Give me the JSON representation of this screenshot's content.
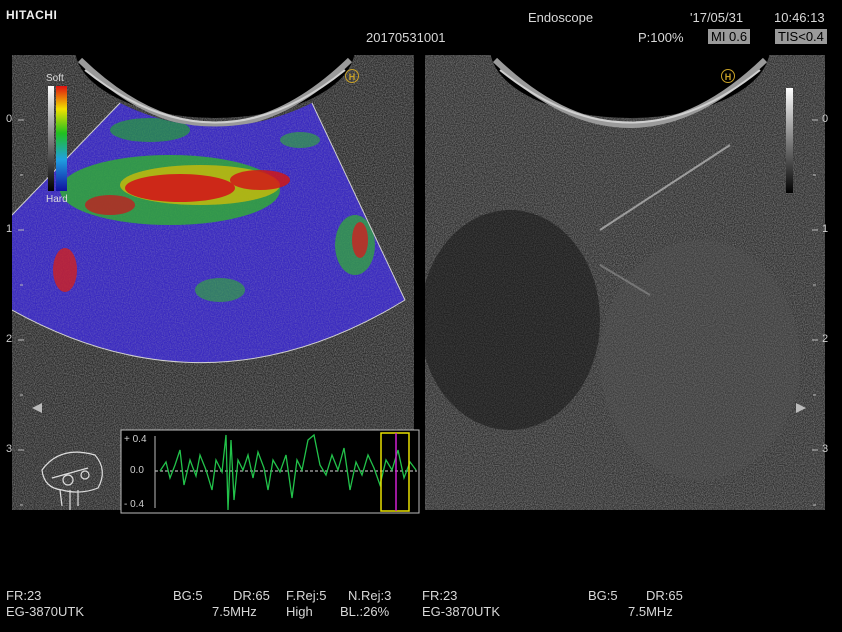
{
  "header": {
    "brand": "HITACHI",
    "mode": "Endoscope",
    "date": "'17/05/31",
    "time": "10:46:13",
    "patient_id": "20170531001",
    "power": "P:100%",
    "mi": "MI 0.6",
    "tis": "TIS<0.4"
  },
  "left_image": {
    "scale_soft": "Soft",
    "scale_hard": "Hard",
    "depth_ticks": [
      "0",
      "1",
      "2",
      "3"
    ],
    "h_marker": "H",
    "graph": {
      "y_labels": [
        "+ 0.4",
        "0.0",
        "- 0.4"
      ]
    }
  },
  "right_image": {
    "depth_ticks": [
      "0",
      "1",
      "2",
      "3"
    ],
    "h_marker": "H"
  },
  "footer": {
    "left_row1": [
      "FR:23",
      "BG:5",
      "DR:65",
      "F.Rej:5",
      "N.Rej:3"
    ],
    "left_row2": [
      "EG-3870UTK",
      "7.5MHz",
      "High",
      "BL.:26%"
    ],
    "right_row1": [
      "FR:23",
      "BG:5",
      "DR:65"
    ],
    "right_row2": [
      "EG-3870UTK",
      "7.5MHz"
    ]
  },
  "colors": {
    "background": "#000000",
    "marker": "#c9a227",
    "graph_line": "#22c24a",
    "roi_yellow": "#e8e000",
    "roi_magenta": "#d020d0"
  }
}
